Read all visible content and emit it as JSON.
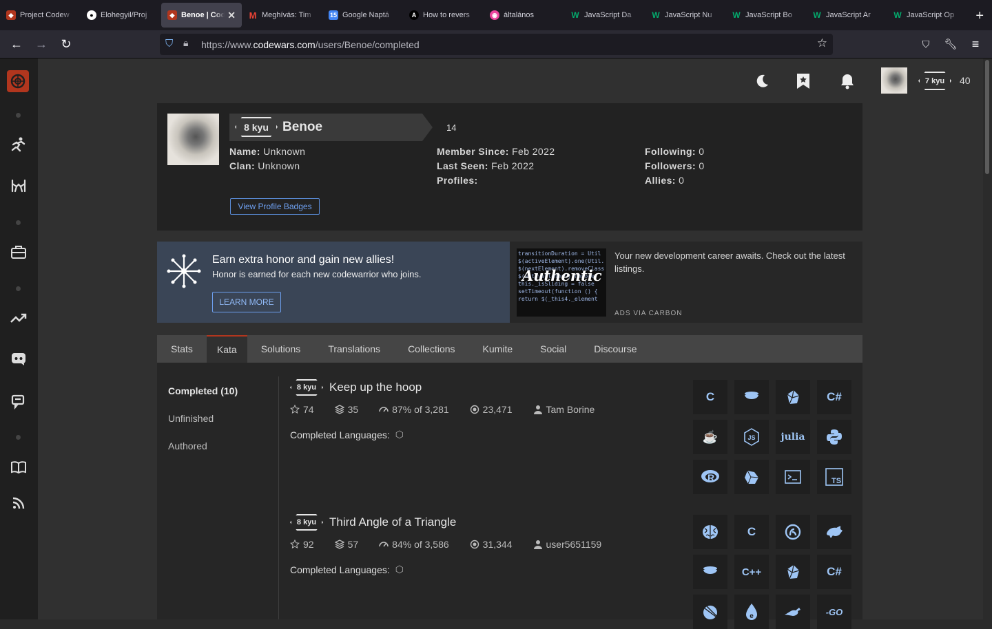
{
  "browser": {
    "tabs": [
      {
        "label": "Project Codew",
        "icon": "codewars-icon",
        "color": "#b1361e"
      },
      {
        "label": "Elohegyil/Proj",
        "icon": "github-icon",
        "color": "#ffffff"
      },
      {
        "label": "Benoe | Cod",
        "icon": "codewars-icon",
        "color": "#b1361e",
        "active": true
      },
      {
        "label": "Meghívás: Tim",
        "icon": "gmail-icon",
        "color": "#ea4335"
      },
      {
        "label": "Google Naptá",
        "icon": "calendar-icon",
        "color": "#4285f4"
      },
      {
        "label": "How to revers",
        "icon": "dev-icon",
        "color": "#6b5bd6"
      },
      {
        "label": "általános",
        "icon": "discord-icon",
        "color": "#eb459e"
      },
      {
        "label": "JavaScript Da",
        "icon": "w3schools-icon",
        "color": "#04aa6d"
      },
      {
        "label": "JavaScript Nu",
        "icon": "w3schools-icon",
        "color": "#04aa6d"
      },
      {
        "label": "JavaScript Bo",
        "icon": "w3schools-icon",
        "color": "#04aa6d"
      },
      {
        "label": "JavaScript Ar",
        "icon": "w3schools-icon",
        "color": "#04aa6d"
      },
      {
        "label": "JavaScript Op",
        "icon": "w3schools-icon",
        "color": "#04aa6d"
      }
    ],
    "url_prefix": "https://www.",
    "url_domain": "codewars.com",
    "url_path": "/users/Benoe/completed"
  },
  "header": {
    "rank": "7 kyu",
    "honor": "40"
  },
  "profile": {
    "rank": "8 kyu",
    "username": "Benoe",
    "honor": "14",
    "name_label": "Name:",
    "name_value": "Unknown",
    "clan_label": "Clan:",
    "clan_value": "Unknown",
    "member_label": "Member Since:",
    "member_value": "Feb 2022",
    "seen_label": "Last Seen:",
    "seen_value": "Feb 2022",
    "profiles_label": "Profiles:",
    "following_label": "Following:",
    "following_value": "0",
    "followers_label": "Followers:",
    "followers_value": "0",
    "allies_label": "Allies:",
    "allies_value": "0",
    "badges_button": "View Profile Badges"
  },
  "promo": {
    "title": "Earn extra honor and gain new allies!",
    "text": "Honor is earned for each new codewarrior who joins.",
    "button": "LEARN MORE"
  },
  "ad": {
    "text": "Your new development career awaits. Check out the latest listings.",
    "via": "ADS VIA CARBON",
    "image_text": "Authentic"
  },
  "tabs": [
    "Stats",
    "Kata",
    "Solutions",
    "Translations",
    "Collections",
    "Kumite",
    "Social",
    "Discourse"
  ],
  "active_tab": "Kata",
  "left_nav": [
    "Completed (10)",
    "Unfinished",
    "Authored"
  ],
  "katas": [
    {
      "rank": "8 kyu",
      "title": "Keep up the hoop",
      "stars": "74",
      "collections": "35",
      "satisfaction": "87% of 3,281",
      "completed": "23,471",
      "author": "Tam Borine",
      "languages_label": "Completed Languages:",
      "languages": [
        "c-icon",
        "coffeescript-icon",
        "crystal-icon",
        "csharp-icon",
        "java-icon",
        "nodejs-icon",
        "julia-icon",
        "python-icon",
        "r-icon",
        "reason-icon",
        "shell-icon",
        "typescript-icon"
      ]
    },
    {
      "rank": "8 kyu",
      "title": "Third Angle of a Triangle",
      "stars": "92",
      "collections": "57",
      "satisfaction": "84% of 3,586",
      "completed": "31,344",
      "author": "user5651159",
      "languages_label": "Completed Languages:",
      "languages": [
        "brainfuck-icon",
        "c-icon",
        "clojure-icon",
        "cobol-icon",
        "coffeescript-icon",
        "cpp-icon",
        "crystal-icon",
        "csharp-icon",
        "dart-icon",
        "elixir-icon",
        "elm-icon",
        "go-icon"
      ]
    }
  ],
  "lang_glyphs": {
    "c": "C",
    "csharp": "C#",
    "cpp": "C++",
    "julia": "julia",
    "go": "GO",
    "java": "☕",
    "ts": "TS",
    "js": "JS",
    "shell": ">_",
    "r": "R",
    "e": "e"
  }
}
